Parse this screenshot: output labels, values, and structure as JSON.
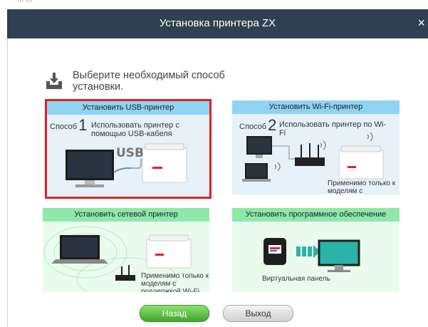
{
  "window": {
    "title": "Установка принтера ZX",
    "close_glyph": "×",
    "top_strip_text": "... ..."
  },
  "heading": {
    "text": "Выберите необходимый способ установки.",
    "icon": "download-tray-icon"
  },
  "cards": {
    "usb": {
      "title": "Установить USB-принтер",
      "method_label": "Способ",
      "method_number": "1",
      "description": "Использовать принтер с помощью USB-кабеля",
      "cable_label": "USB"
    },
    "wifi": {
      "title": "Установить Wi-Fi-принтер",
      "method_label": "Способ",
      "method_number": "2",
      "description": "Использовать принтер по Wi-Fi",
      "note": "Применимо только к моделям с поддержкой Wi-Fi"
    },
    "network": {
      "title": "Установить сетевой принтер",
      "note": "Применимо только к моделям с поддержкой Wi-Fi"
    },
    "software": {
      "title": "Установить программное обеспечение",
      "label": "Виртуальная панель"
    }
  },
  "buttons": {
    "back": "Назад",
    "exit": "Выход"
  },
  "colors": {
    "titlebar": "#2f4050",
    "blue_header": "#8fd3f2",
    "green_header": "#8ee8a8",
    "selection_outline": "#e02020"
  }
}
